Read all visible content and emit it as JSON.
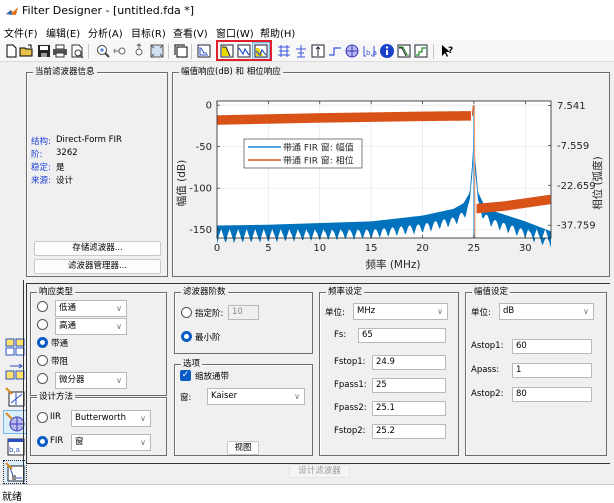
{
  "window": {
    "title": "Filter Designer -  [untitled.fda *]",
    "app_icon": "matlab-icon"
  },
  "menu": [
    "文件(F)",
    "编辑(E)",
    "分析(A)",
    "目标(R)",
    "查看(V)",
    "窗口(W)",
    "帮助(H)"
  ],
  "toolbar": {
    "icons": [
      "new-icon",
      "open-icon",
      "save-icon",
      "print-icon",
      "print-preview-icon",
      "zoom-in-icon",
      "zoom-x-icon",
      "zoom-y-icon",
      "full-view-icon",
      "new-figure-icon",
      "design-filter-icon",
      "magnitude-response-icon",
      "phase-response-icon",
      "magnitude-phase-response-icon",
      "group-delay-icon",
      "phase-delay-icon",
      "impulse-response-icon",
      "step-response-icon",
      "pole-zero-icon",
      "coefficients-icon",
      "filter-info-icon",
      "magnitude-estimate-icon",
      "round-off-noise-icon",
      "whats-this-icon"
    ],
    "highlighted": [
      "magnitude-response-icon",
      "phase-response-icon",
      "magnitude-phase-response-icon"
    ],
    "highlight_color": "#e0202a"
  },
  "filter_info": {
    "title": "当前滤波器信息",
    "rows": [
      {
        "label": "结构:",
        "value": "Direct-Form FIR"
      },
      {
        "label": "阶:",
        "value": "3262"
      },
      {
        "label": "稳定:",
        "value": "是"
      },
      {
        "label": "来源:",
        "value": "设计"
      }
    ],
    "store_button": "存储滤波器...",
    "manager_button": "滤波器管理器..."
  },
  "plot_panel": {
    "title": "幅值响应(dB) 和 相位响应"
  },
  "chart_data": {
    "type": "line",
    "title": "",
    "xlabel": "频率 (MHz)",
    "ylabel": "幅值 (dB)",
    "y2label": "相位 (弧度)",
    "xlim": [
      0,
      32.5
    ],
    "ylim": [
      -160,
      5
    ],
    "y2lim": [
      -42.6,
      9.2
    ],
    "xticks": [
      0,
      5,
      10,
      15,
      20,
      25,
      30
    ],
    "yticks": [
      0,
      -50,
      -100,
      -150
    ],
    "y2ticks": [
      "7.541",
      "-7.559",
      "-22.659",
      "-37.759"
    ],
    "y2tick_values": [
      7.541,
      -7.559,
      -22.659,
      -37.759
    ],
    "grid": true,
    "legend": {
      "placement": "upper-left",
      "entries": [
        "带通 FIR 窗: 幅值",
        "带通 FIR 窗: 相位"
      ]
    },
    "series": [
      {
        "name": "带通 FIR 窗: 幅值",
        "color": "#0072bd",
        "axis": "left",
        "description": "passband peak at 25 MHz (0 dB), stopband floor rising from ~-145 dB to ~-115 dB near 24.5 MHz, falling to ~-150 dB at 32.5 MHz",
        "x": [
          0,
          5,
          10,
          15,
          20,
          23,
          24,
          24.6,
          24.9,
          25,
          25.1,
          25.4,
          26,
          27,
          30,
          32.5
        ],
        "y": [
          -145,
          -144,
          -142,
          -140,
          -133,
          -125,
          -118,
          -105,
          -60,
          0,
          -60,
          -105,
          -120,
          -128,
          -140,
          -152
        ]
      },
      {
        "name": "带通 FIR 窗: 相位",
        "color": "#d95319",
        "axis": "right",
        "description": "phase band around 3 rad before 25 MHz, jumps to ~-30 rad after",
        "x": [
          0,
          5,
          10,
          15,
          20,
          24.8,
          24.95,
          25.2,
          28,
          32.5
        ],
        "y": [
          2.0,
          2.4,
          2.8,
          3.1,
          3.4,
          3.6,
          7.5,
          -31.5,
          -30.5,
          -28.0
        ]
      }
    ]
  },
  "response_type": {
    "title": "响应类型",
    "options": [
      {
        "label": "低通",
        "type": "select",
        "selected": false
      },
      {
        "label": "高通",
        "type": "select",
        "selected": false
      },
      {
        "label": "带通",
        "type": "radio",
        "selected": true
      },
      {
        "label": "带阻",
        "type": "radio",
        "selected": false
      },
      {
        "label": "微分器",
        "type": "select",
        "selected": false
      }
    ]
  },
  "design_method": {
    "title": "设计方法",
    "iir_label": "IIR",
    "iir_value": "Butterworth",
    "iir_selected": false,
    "fir_label": "FIR",
    "fir_value": "窗",
    "fir_selected": true
  },
  "filter_order": {
    "title": "滤波器阶数",
    "specify_label": "指定阶:",
    "specify_value": "10",
    "specify_selected": false,
    "min_label": "最小阶",
    "min_selected": true
  },
  "options": {
    "title": "选项",
    "scale_label": "缩放通带",
    "scale_checked": true,
    "window_label": "窗:",
    "window_value": "Kaiser",
    "view_button": "视图"
  },
  "freq_spec": {
    "title": "频率设定",
    "units_label": "单位:",
    "units_value": "MHz",
    "fields": [
      {
        "label": "Fs:",
        "value": "65"
      },
      {
        "label": "Fstop1:",
        "value": "24.9"
      },
      {
        "label": "Fpass1:",
        "value": "25"
      },
      {
        "label": "Fpass2:",
        "value": "25.1"
      },
      {
        "label": "Fstop2:",
        "value": "25.2"
      }
    ]
  },
  "mag_spec": {
    "title": "幅值设定",
    "units_label": "单位:",
    "units_value": "dB",
    "fields": [
      {
        "label": "Astop1:",
        "value": "60"
      },
      {
        "label": "Apass:",
        "value": "1"
      },
      {
        "label": "Astop2:",
        "value": "80"
      }
    ]
  },
  "design_button": "设计滤波器",
  "sidebar": [
    "transform-filter-icon",
    "realize-model-icon",
    "pole-zero-editor-icon",
    "multirate-icon",
    "import-filter-icon",
    "design-filter-sidebar-icon"
  ],
  "status": "就绪"
}
